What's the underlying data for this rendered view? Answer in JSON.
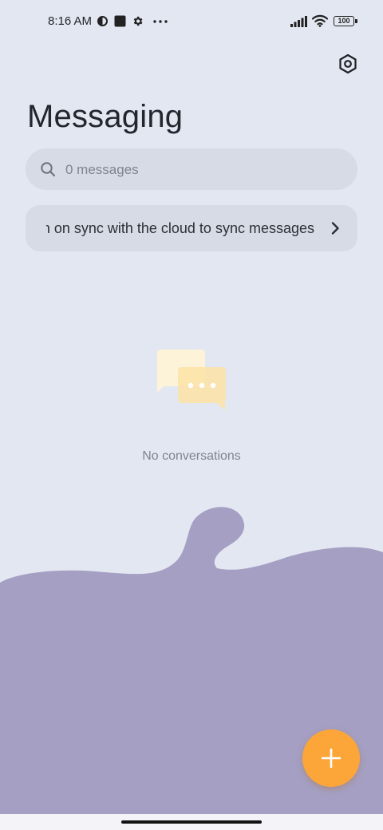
{
  "status_bar": {
    "time": "8:16 AM",
    "battery_level": "100",
    "icons": [
      "vpn-icon",
      "square-notification-icon",
      "gear-icon",
      "more-dots-icon",
      "signal-icon",
      "wifi-icon",
      "battery-icon"
    ]
  },
  "header": {
    "title": "Messaging",
    "settings_icon": "settings-hexagon-icon"
  },
  "search": {
    "placeholder": "0 messages",
    "icon": "search-icon"
  },
  "sync_banner": {
    "label": "Turn on sync with the cloud to sync messages",
    "icon": "chevron-right-icon"
  },
  "empty_state": {
    "illustration": "chat-bubbles-icon",
    "text": "No conversations"
  },
  "fab": {
    "icon": "plus-icon"
  },
  "colors": {
    "background": "#e3e7f1",
    "card": "#d7dbe5",
    "blob": "#a49fc3",
    "fab": "#fca63a",
    "illustration_back": "#fdf3d9",
    "illustration_front": "#fde5b0"
  }
}
